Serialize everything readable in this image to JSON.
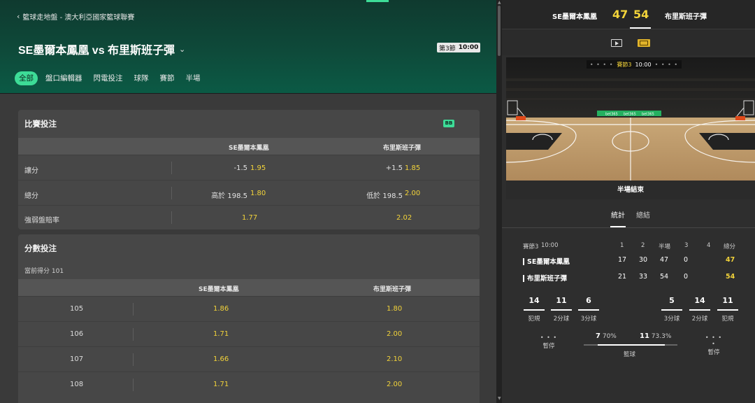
{
  "breadcrumb": "籃球走地盤 - 澳大利亞國家籃球聯賽",
  "match_title": "SE墨爾本鳳凰 vs 布里斯班子彈",
  "clock": {
    "period": "第3節",
    "time": "10:00"
  },
  "tabs": [
    {
      "label": "全部"
    },
    {
      "label": "盤口編輯器"
    },
    {
      "label": "閃電投注"
    },
    {
      "label": "球隊"
    },
    {
      "label": "賽節"
    },
    {
      "label": "半場"
    }
  ],
  "match_bets": {
    "title": "比賽投注",
    "badge": "BB",
    "columns": [
      "SE墨爾本鳳凰",
      "布里斯班子彈"
    ],
    "rows": [
      {
        "label": "讓分",
        "home_line": "-1.5",
        "home_odds": "1.95",
        "away_line": "+1.5",
        "away_odds": "1.85"
      },
      {
        "label": "總分",
        "home_line": "高於 198.5",
        "home_odds": "1.80",
        "away_line": "低於 198.5",
        "away_odds": "2.00"
      },
      {
        "label": "強弱盤賠率",
        "home_line": "",
        "home_odds": "1.77",
        "away_line": "",
        "away_odds": "2.02"
      }
    ]
  },
  "points_bets": {
    "title": "分數投注",
    "subtitle": "當前得分 101",
    "columns": [
      "SE墨爾本鳳凰",
      "布里斯班子彈"
    ],
    "rows": [
      {
        "points": "105",
        "home": "1.86",
        "away": "1.80"
      },
      {
        "points": "106",
        "home": "1.71",
        "away": "2.00"
      },
      {
        "points": "107",
        "home": "1.66",
        "away": "2.10"
      },
      {
        "points": "108",
        "home": "1.71",
        "away": "2.00"
      }
    ]
  },
  "scoreboard": {
    "home": "SE墨爾本鳳凰",
    "home_score": "47",
    "away_score": "54",
    "away": "布里斯班子彈"
  },
  "arena": {
    "status_dots": "• • • •",
    "period": "賽節3",
    "time": "10:00",
    "board_text": "bet365",
    "status": "半場結束"
  },
  "stats_tabs": [
    "統計",
    "總結"
  ],
  "stats_table": {
    "header": {
      "period": "賽節3",
      "time": "10:00",
      "cols": [
        "1",
        "2",
        "半場",
        "3",
        "4",
        "總分"
      ]
    },
    "teams": [
      {
        "name": "SE墨爾本鳳凰",
        "q1": "17",
        "q2": "30",
        "half": "47",
        "q3": "0",
        "total": "47"
      },
      {
        "name": "布里斯班子彈",
        "q1": "21",
        "q2": "33",
        "half": "54",
        "q3": "0",
        "total": "54"
      }
    ]
  },
  "team_stats": {
    "home": [
      {
        "value": "14",
        "label": "犯規"
      },
      {
        "value": "11",
        "label": "2分球"
      },
      {
        "value": "6",
        "label": "3分球"
      }
    ],
    "away": [
      {
        "value": "5",
        "label": "3分球"
      },
      {
        "value": "14",
        "label": "2分球"
      },
      {
        "value": "11",
        "label": "犯規"
      }
    ],
    "timeout_label": "暫停",
    "timeout_home": "• • •",
    "timeout_away": "• • • •",
    "rebounds": {
      "label": "籃球",
      "home": "7",
      "home_pct": "70%",
      "away": "11",
      "away_pct": "73.3%"
    }
  },
  "colors": {
    "accent": "#3ddc97",
    "odds": "#f2d33a",
    "header_green": "#0e4a3a"
  }
}
